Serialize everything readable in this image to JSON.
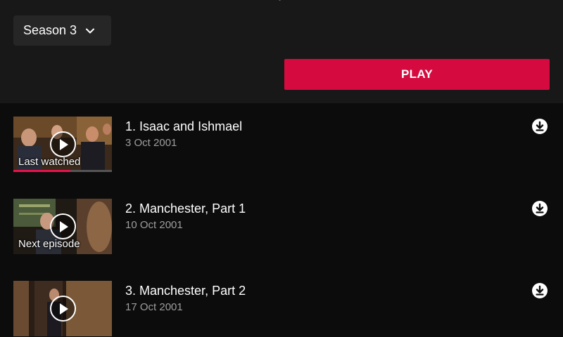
{
  "header": {
    "clipped_title": "y",
    "season_selector": {
      "value": "Season 3",
      "icon": "chevron-down-icon"
    },
    "play_button_label": "PLAY"
  },
  "colors": {
    "accent": "#d50b3f",
    "progress": "#e8124d",
    "background": "#0c0c0c",
    "header_background": "#181818"
  },
  "episodes": [
    {
      "title": "1. Isaac and Ishmael",
      "date": "3 Oct 2001",
      "thumb_caption": "Last watched",
      "progress_fraction": 0.58,
      "play_icon": "play-icon",
      "download_icon": "download-icon"
    },
    {
      "title": "2. Manchester, Part 1",
      "date": "10 Oct 2001",
      "thumb_caption": "Next episode",
      "play_icon": "play-icon",
      "download_icon": "download-icon"
    },
    {
      "title": "3. Manchester, Part 2",
      "date": "17 Oct 2001",
      "thumb_caption": "",
      "play_icon": "play-icon",
      "download_icon": "download-icon"
    }
  ]
}
